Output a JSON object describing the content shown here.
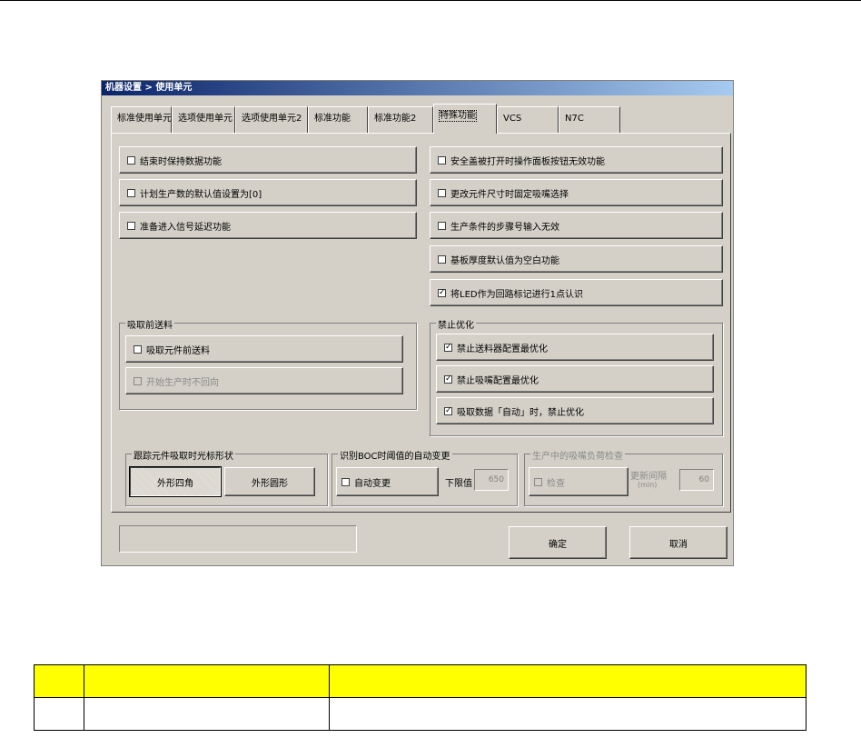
{
  "window": {
    "title": "机器设置 > 使用单元"
  },
  "tabs": [
    {
      "label": "标准使用单元",
      "active": false
    },
    {
      "label": "选项使用单元",
      "active": false
    },
    {
      "label": "选项使用单元2",
      "active": false
    },
    {
      "label": "标准功能",
      "active": false
    },
    {
      "label": "标准功能2",
      "active": false
    },
    {
      "label": "特殊功能",
      "active": true
    },
    {
      "label": "VCS",
      "active": false
    },
    {
      "label": "N7C",
      "active": false
    }
  ],
  "left_options": [
    {
      "label": "结束时保持数据功能",
      "checked": false
    },
    {
      "label": "计划生产数的默认值设置为[0]",
      "checked": false
    },
    {
      "label": "准备进入信号延迟功能",
      "checked": false
    }
  ],
  "right_options": [
    {
      "label": "安全盖被打开时操作面板按钮无效功能",
      "checked": false
    },
    {
      "label": "更改元件尺寸时固定吸嘴选择",
      "checked": false
    },
    {
      "label": "生产条件的步骤号输入无效",
      "checked": false
    },
    {
      "label": "基板厚度默认值为空白功能",
      "checked": false
    },
    {
      "label": "将LED作为回路标记进行1点认识",
      "checked": true
    }
  ],
  "feed_group": {
    "label": "吸取前送料",
    "options": [
      {
        "label": "吸取元件前送料",
        "checked": false,
        "enabled": true
      },
      {
        "label": "开始生产时不回向",
        "checked": false,
        "enabled": false
      }
    ]
  },
  "optimize_group": {
    "label": "禁止优化",
    "options": [
      {
        "label": "禁止送料器配置最优化",
        "checked": true
      },
      {
        "label": "禁止吸嘴配置最优化",
        "checked": true
      },
      {
        "label": "吸取数据「自动」时，禁止优化",
        "checked": true
      }
    ]
  },
  "cursor_group": {
    "label": "跟踪元件吸取时光标形状",
    "btn_rect": "外形四角",
    "btn_circle": "外形圆形"
  },
  "bocr_group": {
    "label": "识别BOC时阈值的自动变更",
    "auto_label": "自动变更",
    "auto_checked": false,
    "lower_label": "下限值",
    "lower_value": "650"
  },
  "nozzle_group": {
    "label": "生产中的吸嘴负荷检查",
    "check_label": "检查",
    "interval_label": "更新间隔",
    "interval_unit": "(min)",
    "interval_value": "60"
  },
  "footer": {
    "ok_label": "确定",
    "cancel_label": "取消",
    "status_text": ""
  },
  "legend_table": {
    "header": [
      "",
      "",
      ""
    ],
    "row": [
      "",
      "",
      ""
    ]
  },
  "colors": {
    "dialog_bg": "#d4d0c8",
    "title_start": "#0a246a",
    "title_end": "#a6caf0",
    "table_header": "#ffff00"
  }
}
